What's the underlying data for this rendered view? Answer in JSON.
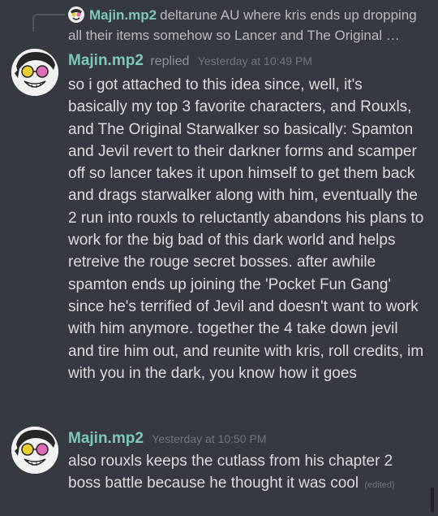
{
  "reply_preview": {
    "author": "Majin.mp2",
    "text": "deltarune AU where kris ends up dropping all their items somehow so Lancer and The Original …"
  },
  "messages": [
    {
      "author": "Majin.mp2",
      "action": "replied",
      "timestamp": "Yesterday at 10:49 PM",
      "text": "so i got attached to this idea since, well, it's basically my top 3 favorite characters, and Rouxls, and The Original Starwalker so basically: Spamton and Jevil revert to their darkner forms and scamper off so lancer takes it upon himself to get them back and drags starwalker along with him, eventually the 2 run into rouxls to reluctantly abandons his plans to work for the big bad of this dark world and helps retreive the rouge secret bosses. after awhile spamton ends up joining the 'Pocket Fun Gang' since he's terrified of Jevil and doesn't want to work with him anymore. together the 4 take down jevil and tire him out, and reunite with kris, roll credits, im with you in the dark, you know how it goes"
    },
    {
      "author": "Majin.mp2",
      "timestamp": "Yesterday at 10:50 PM",
      "text": "also rouxls keeps the cutlass from his chapter 2 boss battle because he thought it was cool",
      "edited_label": "(edited)"
    }
  ],
  "colors": {
    "background": "#36393f",
    "author": "#7ec8b6",
    "text": "#dcddde",
    "muted": "#72767d"
  }
}
